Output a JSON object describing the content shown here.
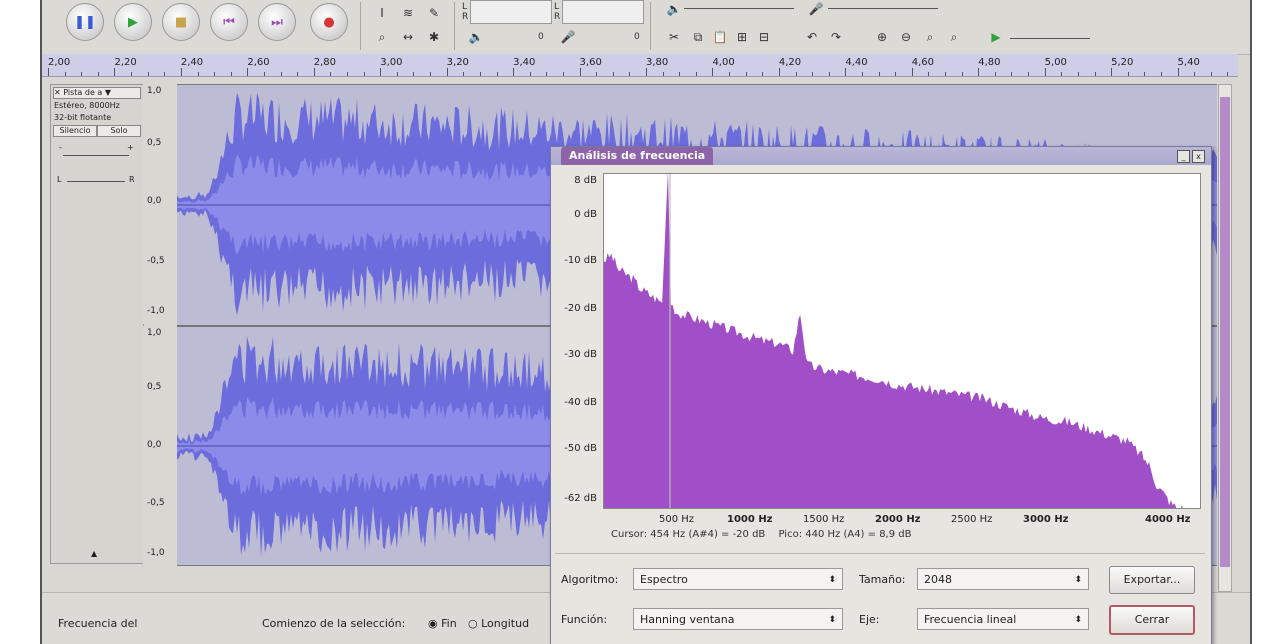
{
  "track": {
    "name": "Pista de a",
    "format": "Estéreo, 8000Hz",
    "bits": "32-bit flotante",
    "mute_label": "Silencio",
    "solo_label": "Solo",
    "gain_minus": "-",
    "gain_plus": "+",
    "pan_left": "L",
    "pan_right": "R",
    "collapse_icon": "▲"
  },
  "ruler": {
    "labels": [
      "2,00",
      "2,20",
      "2,40",
      "2,60",
      "2,80",
      "3,00",
      "3,20",
      "3,40",
      "3,60",
      "3,80",
      "4,00",
      "4,20",
      "4,40",
      "4,60",
      "4,80",
      "5,00",
      "5,20",
      "5,40"
    ]
  },
  "scale": [
    "1,0",
    "0,5",
    "0,0",
    "-0,5",
    "-1,0"
  ],
  "meter": {
    "l": "L",
    "r": "R",
    "zero1": "0",
    "zero2": "0"
  },
  "dialog": {
    "title": "Análisis de frecuencia",
    "min_label": "_",
    "close_label": "x",
    "cursor_text": "Cursor: 454 Hz (A#4) = -20 dB",
    "peak_text": "Pico: 440 Hz (A4) = 8,9 dB",
    "algorithm_label": "Algoritmo:",
    "algorithm_value": "Espectro",
    "size_label": "Tamaño:",
    "size_value": "2048",
    "function_label": "Función:",
    "function_value": "Hanning ventana",
    "axis_label": "Eje:",
    "axis_value": "Frecuencia lineal",
    "export_label": "Exportar...",
    "close_button": "Cerrar"
  },
  "bottom": {
    "freq_label": "Frecuencia del",
    "selection_label": "Comienzo de la selección:",
    "end_label": "Fin",
    "length_label": "Longitud"
  },
  "chart_data": {
    "type": "area",
    "title": "",
    "xlabel": "",
    "ylabel": "",
    "xlim": [
      0,
      4100
    ],
    "ylim": [
      -62,
      8
    ],
    "x_ticks": [
      "500 Hz",
      "1000 Hz",
      "1500 Hz",
      "2000 Hz",
      "2500 Hz",
      "3000 Hz",
      "4000 Hz"
    ],
    "y_ticks": [
      "8 dB",
      "0 dB",
      "-10 dB",
      "-20 dB",
      "-30 dB",
      "-40 dB",
      "-50 dB",
      "-62 dB"
    ],
    "x": [
      0,
      50,
      100,
      150,
      200,
      250,
      300,
      350,
      400,
      440,
      460,
      500,
      600,
      700,
      800,
      900,
      1000,
      1100,
      1200,
      1300,
      1350,
      1380,
      1400,
      1500,
      1600,
      1700,
      1800,
      1900,
      2000,
      2100,
      2200,
      2300,
      2400,
      2500,
      2600,
      2700,
      2800,
      2900,
      3000,
      3100,
      3200,
      3300,
      3400,
      3500,
      3600,
      3700,
      3750,
      3800,
      3850,
      3900,
      3950,
      4000
    ],
    "y": [
      -10,
      -9,
      -12,
      -13,
      -14,
      -16,
      -17,
      -18,
      -19,
      8.9,
      -19,
      -21,
      -22,
      -23,
      -24,
      -25,
      -26,
      -27,
      -27.5,
      -29,
      -21,
      -28,
      -32,
      -33,
      -33.5,
      -34,
      -34.5,
      -35,
      -36,
      -36.5,
      -37,
      -37.5,
      -38,
      -38.5,
      -39,
      -40,
      -41,
      -42,
      -43,
      -43.5,
      -44,
      -45,
      -46,
      -47,
      -48,
      -51,
      -53,
      -57,
      -59,
      -61,
      -62,
      -62
    ]
  }
}
